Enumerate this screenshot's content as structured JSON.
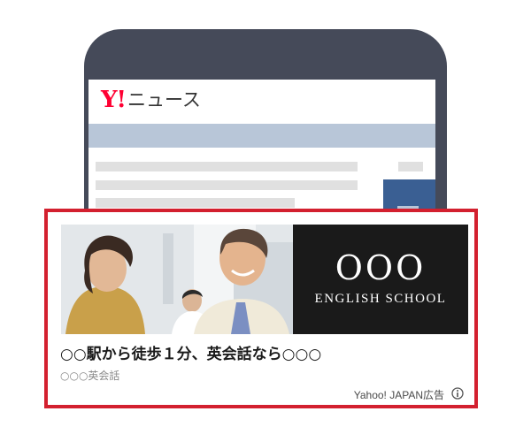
{
  "news_app": {
    "logo_brand": "Y!",
    "logo_title": "ニュース"
  },
  "ad": {
    "school_logo": "OOO",
    "school_subtitle": "ENGLISH SCHOOL",
    "title": "○○駅から徒歩１分、英会話なら○○○",
    "advertiser": "○○○英会話",
    "label": "Yahoo! JAPAN広告",
    "photo_icon": "photo-two-people-icon",
    "info_icon": "info-icon",
    "border_color": "#d3202f"
  }
}
